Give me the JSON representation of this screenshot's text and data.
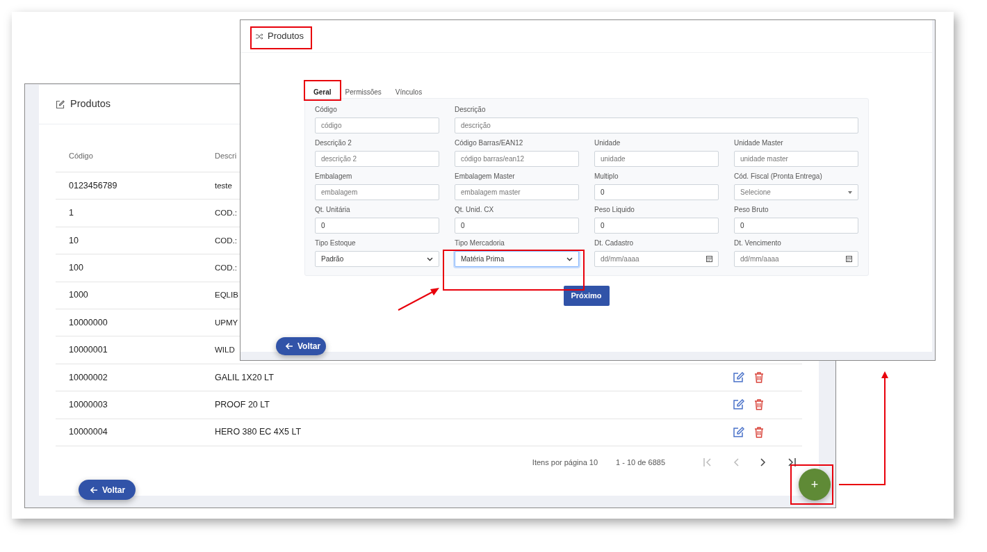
{
  "back_window": {
    "title": "Produtos",
    "table": {
      "columns": [
        "Código",
        "Descri"
      ],
      "rows": [
        {
          "code": "0123456789",
          "description": "teste"
        },
        {
          "code": "1",
          "description": "COD.:"
        },
        {
          "code": "10",
          "description": "COD.:"
        },
        {
          "code": "100",
          "description": "COD.:"
        },
        {
          "code": "1000",
          "description": "EQLIB"
        },
        {
          "code": "10000000",
          "description": "UPMY"
        },
        {
          "code": "10000001",
          "description": "WILD"
        },
        {
          "code": "10000002",
          "description": "GALIL 1X20 LT"
        },
        {
          "code": "10000003",
          "description": "PROOF 20 LT"
        },
        {
          "code": "10000004",
          "description": "HERO 380 EC 4X5 LT"
        }
      ]
    },
    "pagination": {
      "items_per_page": "Itens por página 10",
      "range": "1 - 10 de 6885",
      "buttons": [
        {
          "kind": "first",
          "disabled": true
        },
        {
          "kind": "prev",
          "disabled": true
        },
        {
          "kind": "next",
          "disabled": false
        },
        {
          "kind": "last",
          "disabled": false
        }
      ]
    },
    "back_button": "Voltar",
    "add_button": "+"
  },
  "front_window": {
    "title": "Produtos",
    "tabs": [
      {
        "label": "Geral",
        "selected": true
      },
      {
        "label": "Permissões",
        "selected": false
      },
      {
        "label": "Vínculos",
        "selected": false
      }
    ],
    "fields": [
      {
        "label": "Código",
        "kind": "text",
        "placeholder": "código"
      },
      {
        "label": "Descrição",
        "kind": "text",
        "placeholder": "descrição",
        "wide": true
      },
      {
        "label": "Descrição 2",
        "kind": "text",
        "placeholder": "descrição 2"
      },
      {
        "label": "Código Barras/EAN12",
        "kind": "text",
        "placeholder": "código barras/ean12"
      },
      {
        "label": "Unidade",
        "kind": "text",
        "placeholder": "unidade"
      },
      {
        "label": "Unidade Master",
        "kind": "text",
        "placeholder": "unidade master"
      },
      {
        "label": "Embalagem",
        "kind": "text",
        "placeholder": "embalagem"
      },
      {
        "label": "Embalagem Master",
        "kind": "text",
        "placeholder": "embalagem master"
      },
      {
        "label": "Multiplo",
        "kind": "text",
        "value": "0"
      },
      {
        "label": "Cód. Fiscal (Pronta Entrega)",
        "kind": "dropdown",
        "placeholder": "Selecione"
      },
      {
        "label": "Qt. Unitária",
        "kind": "text",
        "value": "0"
      },
      {
        "label": "Qt. Unid. CX",
        "kind": "text",
        "value": "0"
      },
      {
        "label": "Peso Liquido",
        "kind": "text",
        "value": "0"
      },
      {
        "label": "Peso Bruto",
        "kind": "text",
        "value": "0"
      },
      {
        "label": "Tipo Estoque",
        "kind": "select",
        "value": "Padrão"
      },
      {
        "label": "Tipo Mercadoria",
        "kind": "select",
        "value": "Matéria Prima",
        "focused": true
      },
      {
        "label": "Dt. Cadastro",
        "kind": "date",
        "placeholder": "dd/mm/aaaa"
      },
      {
        "label": "Dt. Vencimento",
        "kind": "date",
        "placeholder": "dd/mm/aaaa"
      }
    ],
    "next_button": "Próximo",
    "back_button": "Voltar"
  }
}
